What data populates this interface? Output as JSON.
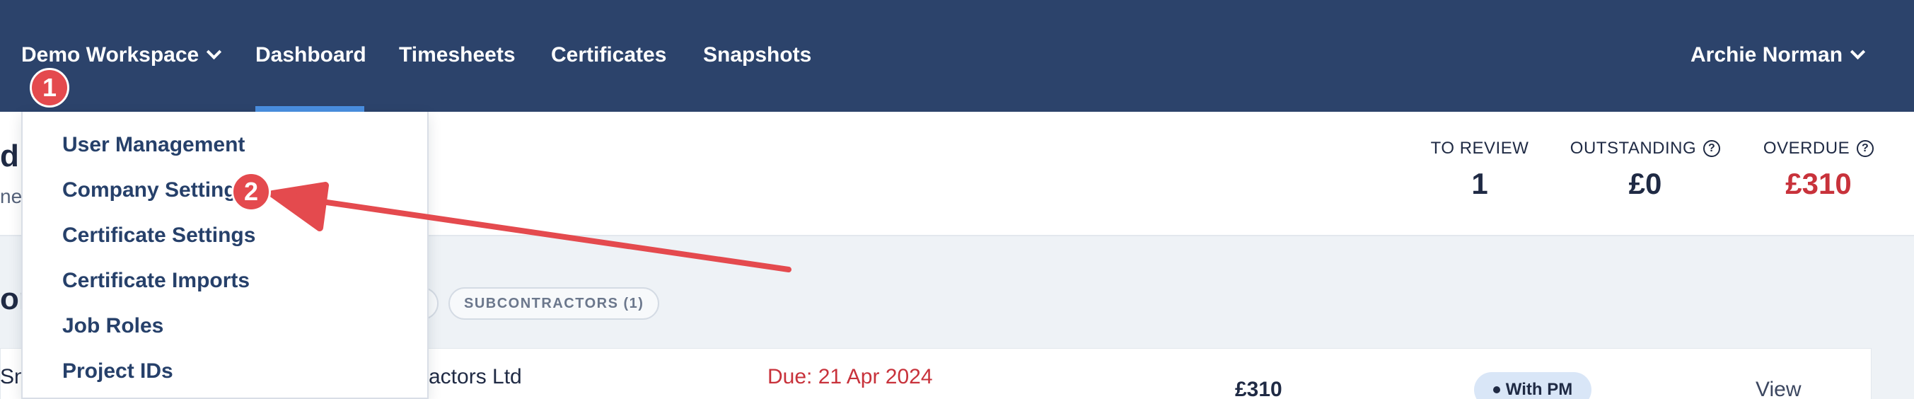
{
  "nav": {
    "workspace": "Demo Workspace",
    "items": [
      "Dashboard",
      "Timesheets",
      "Certificates",
      "Snapshots"
    ],
    "active": "Dashboard",
    "user": "Archie Norman"
  },
  "header": {
    "title_fragment": "d r",
    "subtitle_fragment": "ne"
  },
  "stats": {
    "to_review": {
      "label": "TO REVIEW",
      "value": "1"
    },
    "outstanding": {
      "label": "OUTSTANDING",
      "value": "£0"
    },
    "overdue": {
      "label": "OVERDUE",
      "value": "£310"
    }
  },
  "content": {
    "heading_fragment": "or",
    "filter_pill": "SUBCONTRACTORS (1)"
  },
  "row": {
    "name_fragment": "Sn",
    "company_fragment": "actors Ltd",
    "due": "Due: 21 Apr 2024",
    "amount": "£310",
    "status": "With PM",
    "action": "View"
  },
  "dropdown": {
    "items": [
      "User Management",
      "Company Settings",
      "Certificate Settings",
      "Certificate Imports",
      "Job Roles",
      "Project IDs"
    ]
  },
  "annotations": {
    "step1": "1",
    "step2": "2"
  },
  "colors": {
    "nav_bg": "#2c436b",
    "accent": "#4a8fe0",
    "annotation": "#e44a4e",
    "overdue": "#c8323b"
  }
}
